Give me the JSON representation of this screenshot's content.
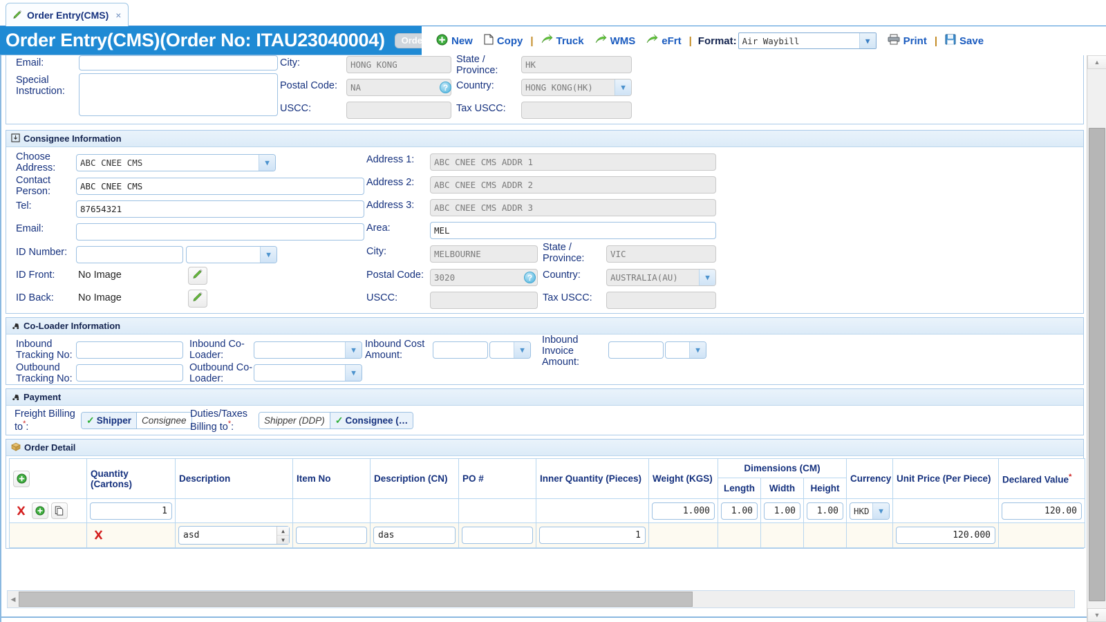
{
  "tab": {
    "label": "Order Entry(CMS)",
    "close": "×",
    "icon": "pencil-icon"
  },
  "header": {
    "title": "Order Entry(CMS)(Order No: ITAU23040004)",
    "badge": "Order",
    "toolbar": {
      "new": "New",
      "copy": "Copy",
      "truck": "Truck",
      "wms": "WMS",
      "efrt": "eFrt",
      "format_label": "Format:",
      "format_value": "Air Waybill",
      "print": "Print",
      "save": "Save",
      "separator": "|"
    }
  },
  "shipper_partial": {
    "email_label": "Email:",
    "email_value": "",
    "special_instruction_label": "Special Instruction:",
    "special_instruction_value": "",
    "city_label": "City:",
    "city_value": "HONG KONG",
    "postal_code_label": "Postal Code:",
    "postal_code_value": "NA",
    "uscc_label": "USCC:",
    "uscc_value": "",
    "state_label": "State / Province:",
    "state_value": "HK",
    "country_label": "Country:",
    "country_value": "HONG KONG(HK)",
    "tax_uscc_label": "Tax USCC:",
    "tax_uscc_value": ""
  },
  "consignee": {
    "section_title": "Consignee Information",
    "choose_address_label": "Choose Address:",
    "choose_address_value": "ABC CNEE CMS",
    "contact_person_label": "Contact Person:",
    "contact_person_value": "ABC CNEE CMS",
    "tel_label": "Tel:",
    "tel_value": "87654321",
    "email_label": "Email:",
    "email_value": "",
    "id_number_label": "ID Number:",
    "id_number_value": "",
    "id_type_value": "",
    "id_front_label": "ID Front:",
    "id_front_value": "No Image",
    "id_back_label": "ID Back:",
    "id_back_value": "No Image",
    "address1_label": "Address 1:",
    "address1_value": "ABC CNEE CMS ADDR 1",
    "address2_label": "Address 2:",
    "address2_value": "ABC CNEE CMS ADDR 2",
    "address3_label": "Address 3:",
    "address3_value": "ABC CNEE CMS ADDR 3",
    "area_label": "Area:",
    "area_value": "MEL",
    "city_label": "City:",
    "city_value": "MELBOURNE",
    "state_label": "State / Province:",
    "state_value": "VIC",
    "postal_code_label": "Postal Code:",
    "postal_code_value": "3020",
    "country_label": "Country:",
    "country_value": "AUSTRALIA(AU)",
    "uscc_label": "USCC:",
    "uscc_value": "",
    "tax_uscc_label": "Tax USCC:",
    "tax_uscc_value": ""
  },
  "coloader": {
    "section_title": "Co-Loader Information",
    "inbound_tracking_label": "Inbound Tracking No:",
    "inbound_tracking_value": "",
    "outbound_tracking_label": "Outbound Tracking No:",
    "outbound_tracking_value": "",
    "inbound_coloader_label": "Inbound Co-Loader:",
    "inbound_coloader_value": "",
    "outbound_coloader_label": "Outbound Co-Loader:",
    "outbound_coloader_value": "",
    "inbound_cost_label": "Inbound Cost Amount:",
    "inbound_cost_value": "",
    "inbound_cost_currency": "",
    "inbound_invoice_label": "Inbound Invoice Amount:",
    "inbound_invoice_value": "",
    "inbound_invoice_currency": ""
  },
  "payment": {
    "section_title": "Payment",
    "freight_billing_label": "Freight Billing to",
    "freight_options": [
      {
        "label": "Shipper",
        "selected": true
      },
      {
        "label": "Consignee",
        "selected": false
      }
    ],
    "duties_billing_label": "Duties/Taxes Billing to",
    "duties_options": [
      {
        "label": "Shipper (DDP)",
        "selected": false
      },
      {
        "label": "Consignee (…",
        "selected": true
      }
    ]
  },
  "order_detail": {
    "section_title": "Order Detail",
    "add_row_icon": "add-icon",
    "columns": [
      "",
      "Quantity (Cartons)",
      "Description",
      "Item No",
      "Description (CN)",
      "PO #",
      "Inner Quantity (Pieces)",
      "Weight (KGS)",
      "Dimensions (CM)",
      "Currency",
      "Unit Price (Per Piece)",
      "Declared Value"
    ],
    "dimension_subcolumns": [
      "Length",
      "Width",
      "Height"
    ],
    "rows": [
      {
        "type": "carton",
        "actions": [
          "delete-icon",
          "add-icon",
          "copy-icon"
        ],
        "quantity": "1",
        "description": "",
        "item_no": "",
        "description_cn": "",
        "po": "",
        "inner_quantity": "",
        "weight": "1.000",
        "length": "1.00",
        "width": "1.00",
        "height": "1.00",
        "currency": "HKD",
        "unit_price": "",
        "declared_value": "120.00"
      },
      {
        "type": "item",
        "actions": [
          "delete-icon"
        ],
        "quantity": "",
        "description": "asd",
        "item_no": "",
        "description_cn": "das",
        "po": "",
        "inner_quantity": "1",
        "weight": "",
        "length": "",
        "width": "",
        "height": "",
        "currency": "",
        "unit_price": "120.000",
        "declared_value": ""
      }
    ]
  },
  "colors": {
    "title_bar": "#1f8ad4",
    "label_text": "#15317e",
    "link_blue": "#1a5bbf",
    "required_red": "#cc2222",
    "green": "#2faf38",
    "panel_border": "#a9c9e8"
  }
}
